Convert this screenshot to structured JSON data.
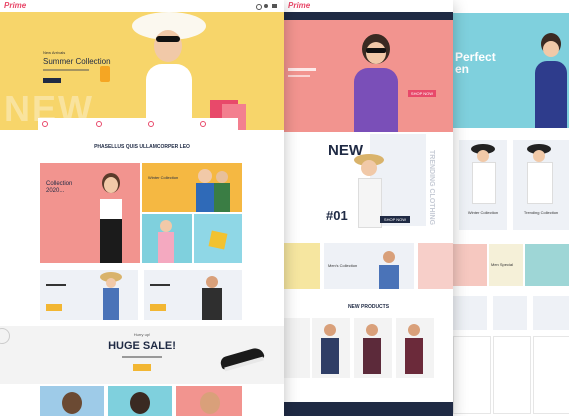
{
  "panel1": {
    "logo": "Prime",
    "hero": {
      "kicker": "New Arrivals",
      "title": "Summer Collection",
      "watermark": "NEW"
    },
    "section_title": "PHASELLUS QUIS ULLAMCORPER LEO",
    "promos": [
      {
        "title": "Collection\n2020..."
      },
      {
        "title": "Winter Collection"
      }
    ],
    "sale": {
      "kicker": "Hurry up!",
      "title": "HUGE SALE!"
    }
  },
  "panel2": {
    "logo": "Prime",
    "hero_button": "SHOP NOW",
    "new_block": {
      "title": "NEW",
      "number": "#01",
      "vertical": "TRENDING CLOTHING",
      "button": "SHOP NOW"
    },
    "mens_label": "Men's Collection",
    "products_title": "NEW PRODUCTS"
  },
  "panel3": {
    "hero_title": "Perfect\nen",
    "items": [
      "Winter Collection",
      "Trending Collection"
    ],
    "mens_special": "Men Special"
  },
  "colors": {
    "yellow": "#f7d56a",
    "pink": "#f2948f",
    "blue": "#7fd0dd",
    "navy": "#1f2a44",
    "accent": "#e8496a"
  }
}
